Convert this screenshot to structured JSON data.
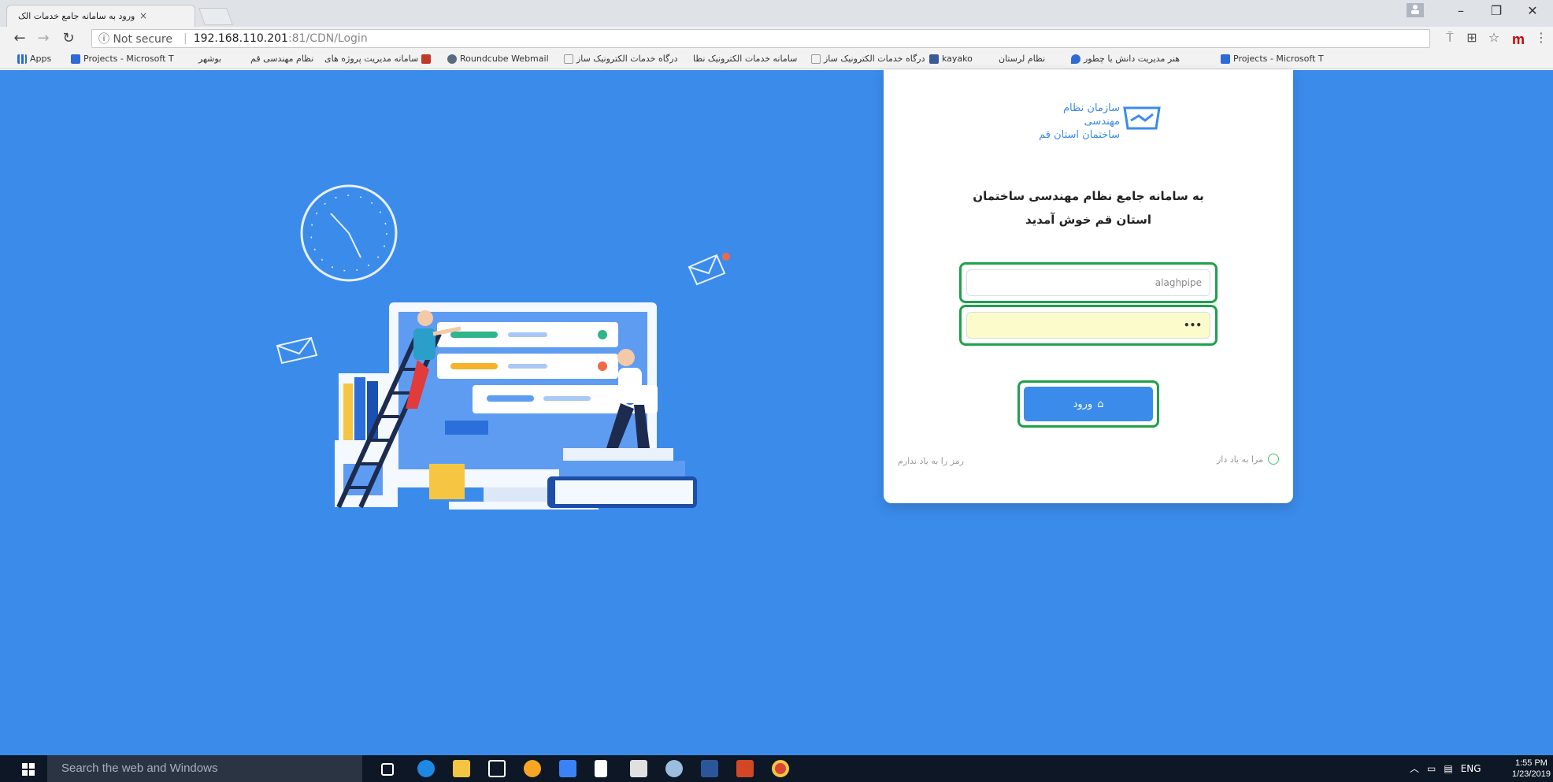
{
  "browser": {
    "tab_title": "ورود به سامانه جامع خدمات الک",
    "tab_close": "×",
    "security_label": "ⓘ Not secure",
    "url_host": "192.168.110.201",
    "url_path": ":81/CDN/Login",
    "window_controls": {
      "minimize": "–",
      "restore": "❐",
      "close": "✕"
    },
    "profile_icon": "person-icon",
    "ext_label": "m"
  },
  "bookmarks": [
    {
      "label": "Apps",
      "icon": "apps-icon",
      "color": "#2d6bd6"
    },
    {
      "label": "Projects - Microsoft T",
      "icon": "folder-icon",
      "color": "#2d6bd6"
    },
    {
      "label": "بوشهر",
      "icon": "page-icon",
      "color": "#cfd6e0"
    },
    {
      "label": "نظام مهندسی قم",
      "icon": "page-icon",
      "color": "#cfd6e0"
    },
    {
      "label": "سامانه مدیریت پروژه های",
      "icon": "bookmark-icon",
      "color": "#c0392b"
    },
    {
      "label": "Roundcube Webmail",
      "icon": "roundcube-icon",
      "color": "#5a6b7d"
    },
    {
      "label": "درگاه خدمات الکترونیک ساز",
      "icon": "page-icon",
      "color": "#cfd6e0"
    },
    {
      "label": "سامانه خدمات الکترونیک نظا",
      "icon": "page-icon",
      "color": "#cfd6e0"
    },
    {
      "label": "درگاه خدمات الکترونیک ساز",
      "icon": "page-icon",
      "color": "#cfd6e0"
    },
    {
      "label": "kayako",
      "icon": "kayako-icon",
      "color": "#3b5998"
    },
    {
      "label": "نظام لرستان",
      "icon": "page-icon",
      "color": "#cfd6e0"
    },
    {
      "label": "هنر مدیریت دانش یا چطور",
      "icon": "location-icon",
      "color": "#2d6bd6"
    },
    {
      "label": "Projects - Microsoft T",
      "icon": "folder-icon",
      "color": "#2d6bd6"
    }
  ],
  "login": {
    "org_line1": "سازمان نظام مهندسی",
    "org_line2": "ساختمان استان قم",
    "welcome_line1": "به سامانه جامع نظام مهندسی ساختمان",
    "welcome_line2": "استان قم خوش آمدید",
    "username_value": "alaghpipe",
    "password_value": "•••",
    "login_button": "ورود",
    "login_icon": "home-icon",
    "remember_me": "مرا به یاد دار",
    "forgot_password": "رمز را به یاد ندارم"
  },
  "taskbar": {
    "search_placeholder": "Search the web and Windows",
    "language": "ENG",
    "time": "1:55 PM",
    "date": "1/23/2019",
    "apps": [
      {
        "name": "task-view-icon",
        "color": "#ffffff"
      },
      {
        "name": "edge-icon",
        "color": "#1e88e5"
      },
      {
        "name": "file-explorer-icon",
        "color": "#f4c542"
      },
      {
        "name": "store-icon",
        "color": "#ffffff"
      },
      {
        "name": "people-icon",
        "color": "#f6a623"
      },
      {
        "name": "teams-icon",
        "color": "#3b82f6"
      },
      {
        "name": "notepad-icon",
        "color": "#ffffff"
      },
      {
        "name": "photos-icon",
        "color": "#e0e0e0"
      },
      {
        "name": "paint-icon",
        "color": "#9bbde0"
      },
      {
        "name": "word-icon",
        "color": "#2b579a"
      },
      {
        "name": "powerpoint-icon",
        "color": "#d24726"
      },
      {
        "name": "chrome-icon",
        "color": "#db4437"
      }
    ]
  },
  "colors": {
    "page_background": "#3b8beb",
    "highlight_outline": "#1fa14a",
    "primary": "#3b8beb"
  }
}
